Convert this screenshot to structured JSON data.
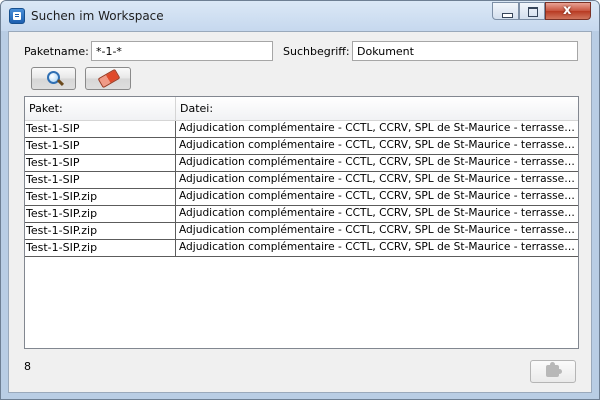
{
  "window": {
    "title": "Suchen im Workspace",
    "close_glyph": "x"
  },
  "form": {
    "package_label": "Paketname:",
    "package_value": "*-1-*",
    "search_label": "Suchbegriff:",
    "search_value": "Dokument"
  },
  "toolbar": {
    "search_icon": "magnifier-icon",
    "clear_icon": "eraser-icon"
  },
  "table": {
    "columns": [
      "Paket:",
      "Datei:"
    ],
    "rows": [
      [
        "Test-1-SIP",
        "Adjudication complémentaire - CCTL, CCRV, SPL de St-Maurice - terrassements et"
      ],
      [
        "Test-1-SIP",
        "Adjudication complémentaire - CCTL, CCRV, SPL de St-Maurice - terrassements et"
      ],
      [
        "Test-1-SIP",
        "Adjudication complémentaire - CCTL, CCRV, SPL de St-Maurice - terrassements et"
      ],
      [
        "Test-1-SIP",
        "Adjudication complémentaire - CCTL, CCRV, SPL de St-Maurice - terrassements et"
      ],
      [
        "Test-1-SIP.zip",
        "Adjudication complémentaire - CCTL, CCRV, SPL de St-Maurice - terrassements et"
      ],
      [
        "Test-1-SIP.zip",
        "Adjudication complémentaire - CCTL, CCRV, SPL de St-Maurice - terrassements et"
      ],
      [
        "Test-1-SIP.zip",
        "Adjudication complémentaire - CCTL, CCRV, SPL de St-Maurice - terrassements et"
      ],
      [
        "Test-1-SIP.zip",
        "Adjudication complémentaire - CCTL, CCRV, SPL de St-Maurice - terrassements et"
      ]
    ]
  },
  "status": {
    "result_count": "8"
  },
  "colors": {
    "titlebar": "#c6d8ee",
    "close_button": "#c7533d",
    "client_background": "#f0f0f0"
  }
}
